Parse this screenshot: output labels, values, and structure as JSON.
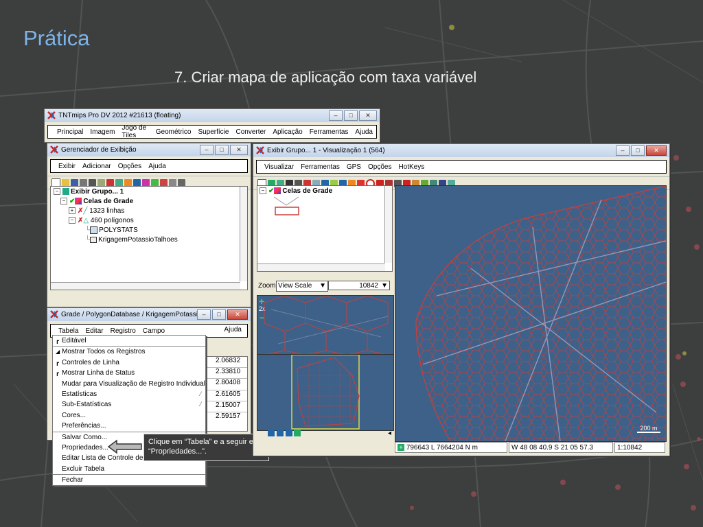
{
  "slide": {
    "title": "Prática",
    "subtitle": "7. Criar mapa de aplicação com taxa variável"
  },
  "main_window": {
    "title": "TNTmips Pro DV 2012  #21613 (floating)",
    "menu": [
      "Principal",
      "Imagem",
      "Jogo de Tiles",
      "Geométrico",
      "Superfície",
      "Converter",
      "Aplicação",
      "Ferramentas",
      "Ajuda"
    ]
  },
  "display_manager": {
    "title": "Gerenciador de Exibição",
    "menu": [
      "Exibir",
      "Adicionar",
      "Opções",
      "Ajuda"
    ],
    "tree": {
      "group": "Exibir Grupo... 1",
      "layer": "Celas de Grade",
      "lines": "1323 linhas",
      "polygons": "460 polígonos",
      "table1": "POLYSTATS",
      "table2": "KrigagemPotassioTalhoes"
    }
  },
  "grid_window": {
    "title": "Grade / PolygonDatabase / KrigagemPotassio...",
    "menu": [
      "Tabela",
      "Editar",
      "Registro",
      "Campo"
    ],
    "help": "Ajuda",
    "values": [
      "2.06832",
      "2.33810",
      "2.80408",
      "2.61605",
      "2.15007",
      "2.59157"
    ]
  },
  "table_menu": {
    "items": [
      {
        "label": "Editável",
        "mark": "r"
      },
      {
        "label": "Mostrar Todos os Registros",
        "mark": "•"
      },
      {
        "label": "Controles de Linha",
        "mark": "r"
      },
      {
        "label": "Mostrar Linha de Status",
        "mark": "r"
      },
      {
        "label": "Mudar para Visualização de Registro Individual",
        "mark": ""
      },
      {
        "label": "Estatísticas",
        "mark": ""
      },
      {
        "label": "Sub-Estatísticas",
        "mark": ""
      },
      {
        "label": "Cores...",
        "mark": ""
      },
      {
        "label": "Preferências...",
        "mark": ""
      },
      {
        "label": "Salvar Como...",
        "mark": ""
      },
      {
        "label": "Propriedades...",
        "mark": ""
      },
      {
        "label": "Editar Lista de Controle de A",
        "mark": ""
      },
      {
        "label": "Excluir Tabela",
        "mark": ""
      },
      {
        "label": "Fechar",
        "mark": ""
      }
    ]
  },
  "callout": {
    "text": "Clique em “Tabela” e a seguir em “Propriedades...”."
  },
  "view_window": {
    "title": "Exibir Grupo... 1 - Visualização 1 (564)",
    "menu": [
      "Visualizar",
      "Ferramentas",
      "GPS",
      "Opções",
      "HotKeys"
    ],
    "legend_layer": "Celas de Grade",
    "zoom_label": "Zoom",
    "zoom_mode": "View Scale",
    "zoom_value": "10842",
    "zoom_factor": "2x",
    "scale_bar": "200 m",
    "status": {
      "coords": "796643 L  7664204 N m",
      "latlon": "W 48 08 40.9  S 21 05 57.3",
      "scale": "1:10842"
    }
  },
  "colors": {
    "title_blue": "#7db3e8",
    "map_bg": "#3d6189",
    "grid_line": "#c9403a"
  }
}
